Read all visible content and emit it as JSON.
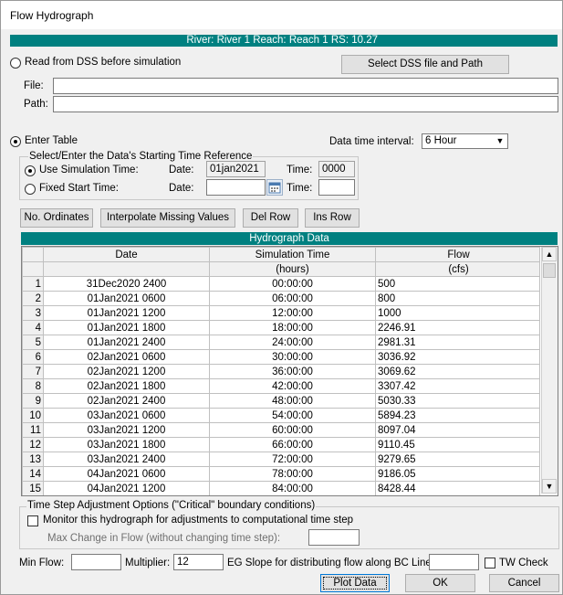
{
  "window": {
    "title": "Flow Hydrograph"
  },
  "location_bar": "River: River 1  Reach: Reach 1  RS: 10.27",
  "dss": {
    "radio_label": "Read from DSS before simulation",
    "select_button": "Select DSS file and Path",
    "file_label": "File:",
    "path_label": "Path:",
    "file_value": "",
    "path_value": ""
  },
  "table_entry": {
    "radio_label": "Enter Table",
    "interval_label": "Data time interval:",
    "interval_value": "6 Hour"
  },
  "time_ref": {
    "group_label": "Select/Enter the Data's Starting Time Reference",
    "use_sim_label": "Use Simulation Time:",
    "fixed_label": "Fixed Start Time:",
    "date_label": "Date:",
    "time_label": "Time:",
    "sim_date": "01jan2021",
    "sim_time": "0000",
    "fixed_date": "",
    "fixed_time": ""
  },
  "toolbar": {
    "no_ordinates": "No. Ordinates",
    "interpolate": "Interpolate Missing Values",
    "del_row": "Del Row",
    "ins_row": "Ins Row"
  },
  "grid": {
    "title": "Hydrograph Data",
    "headers": [
      "Date",
      "Simulation Time",
      "Flow"
    ],
    "units": [
      "",
      "(hours)",
      "(cfs)"
    ],
    "rows": [
      [
        "1",
        "31Dec2020 2400",
        "00:00:00",
        "500"
      ],
      [
        "2",
        "01Jan2021 0600",
        "06:00:00",
        "800"
      ],
      [
        "3",
        "01Jan2021 1200",
        "12:00:00",
        "1000"
      ],
      [
        "4",
        "01Jan2021 1800",
        "18:00:00",
        "2246.91"
      ],
      [
        "5",
        "01Jan2021 2400",
        "24:00:00",
        "2981.31"
      ],
      [
        "6",
        "02Jan2021 0600",
        "30:00:00",
        "3036.92"
      ],
      [
        "7",
        "02Jan2021 1200",
        "36:00:00",
        "3069.62"
      ],
      [
        "8",
        "02Jan2021 1800",
        "42:00:00",
        "3307.42"
      ],
      [
        "9",
        "02Jan2021 2400",
        "48:00:00",
        "5030.33"
      ],
      [
        "10",
        "03Jan2021 0600",
        "54:00:00",
        "5894.23"
      ],
      [
        "11",
        "03Jan2021 1200",
        "60:00:00",
        "8097.04"
      ],
      [
        "12",
        "03Jan2021 1800",
        "66:00:00",
        "9110.45"
      ],
      [
        "13",
        "03Jan2021 2400",
        "72:00:00",
        "9279.65"
      ],
      [
        "14",
        "04Jan2021 0600",
        "78:00:00",
        "9186.05"
      ],
      [
        "15",
        "04Jan2021 1200",
        "84:00:00",
        "8428.44"
      ]
    ]
  },
  "time_step": {
    "group_label": "Time Step Adjustment Options (\"Critical\" boundary conditions)",
    "monitor_label": "Monitor this hydrograph for adjustments to computational time step",
    "max_change_label": "Max Change in Flow (without changing time step):",
    "max_change_value": ""
  },
  "bottom": {
    "min_flow_label": "Min Flow:",
    "min_flow_value": "",
    "multiplier_label": "Multiplier:",
    "multiplier_value": "12",
    "eg_slope_label": "EG Slope for distributing flow along BC Line:",
    "eg_slope_value": "",
    "tw_check_label": "TW Check",
    "plot_button": "Plot Data",
    "ok_button": "OK",
    "cancel_button": "Cancel"
  },
  "icons": {
    "calendar": "calendar-icon",
    "dropdown": "chevron-down-icon",
    "scroll_up": "arrow-up-icon",
    "scroll_down": "arrow-down-icon"
  }
}
